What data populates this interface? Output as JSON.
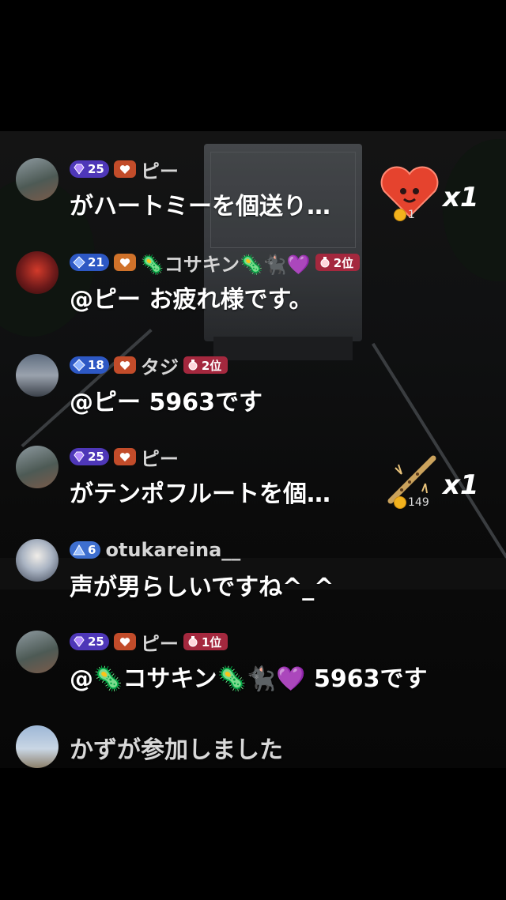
{
  "comments": [
    {
      "user": "ピー",
      "level": "25",
      "level_style": "purple",
      "heart_style": "red",
      "rank": "",
      "message": "がハートミーを個送り…",
      "gift": {
        "name": "heart-me-gift",
        "coin": "1",
        "count": "x1"
      }
    },
    {
      "user": "🦠コサキン🦠🐈‍⬛💜",
      "level": "21",
      "level_style": "blue",
      "heart_style": "orange",
      "rank": "2位",
      "message": "@ピー お疲れ様です。"
    },
    {
      "user": "タジ",
      "level": "18",
      "level_style": "blue",
      "heart_style": "red",
      "rank": "2位",
      "message": "@ピー 5963です"
    },
    {
      "user": "ピー",
      "level": "25",
      "level_style": "purple",
      "heart_style": "red",
      "rank": "",
      "message": "がテンポフルートを個…",
      "gift": {
        "name": "tempo-flute-gift",
        "coin": "149",
        "count": "x1"
      }
    },
    {
      "user": "otukareina__",
      "level": "6",
      "level_style": "lblue",
      "rank": "",
      "message": "声が男らしいですね^_^"
    },
    {
      "user": "ピー",
      "level": "25",
      "level_style": "purple",
      "heart_style": "red",
      "rank": "1位",
      "message": "@🦠コサキン🦠🐈‍⬛💜 5963です"
    },
    {
      "message": "かずが参加しました"
    }
  ],
  "colors": {
    "background": "#000000",
    "level_purple": "#4e37b8",
    "level_blue": "#2d58c4",
    "rank_badge": "#a4283e",
    "coin": "#f2b21d"
  }
}
